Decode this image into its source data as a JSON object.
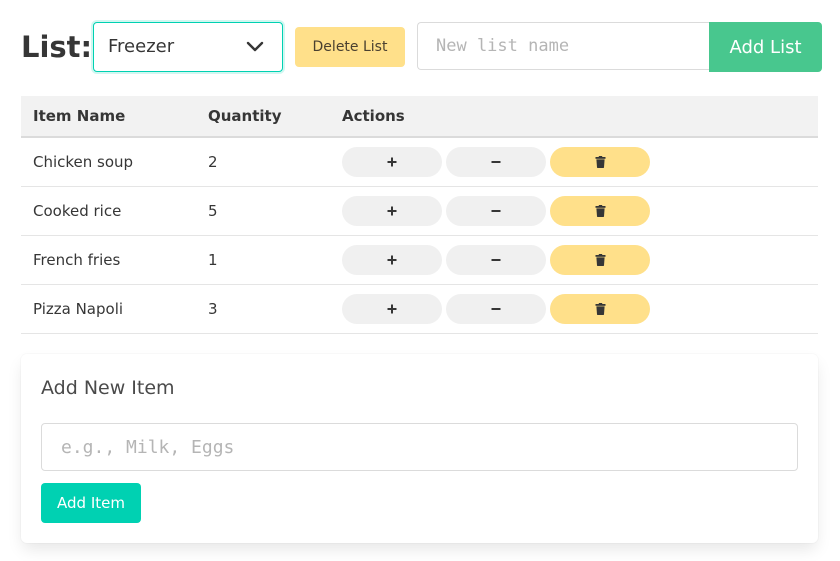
{
  "header": {
    "list_label": "List:",
    "selected_list": "Freezer",
    "delete_list_label": "Delete List",
    "new_list_placeholder": "New list name",
    "add_list_label": "Add List"
  },
  "table": {
    "columns": [
      "Item Name",
      "Quantity",
      "Actions"
    ],
    "rows": [
      {
        "name": "Chicken soup",
        "quantity": "2"
      },
      {
        "name": "Cooked rice",
        "quantity": "5"
      },
      {
        "name": "French fries",
        "quantity": "1"
      },
      {
        "name": "Pizza Napoli",
        "quantity": "3"
      }
    ],
    "actions": {
      "increment_icon": "plus-icon",
      "decrement_icon": "minus-icon",
      "delete_icon": "trash-icon"
    }
  },
  "add_item": {
    "title": "Add New Item",
    "placeholder": "e.g., Milk, Eggs",
    "button_label": "Add Item"
  },
  "colors": {
    "primary": "#00d1b2",
    "success": "#48c78e",
    "warning": "#ffe08a",
    "text": "#363636",
    "header_bg": "#f2f2f2"
  }
}
